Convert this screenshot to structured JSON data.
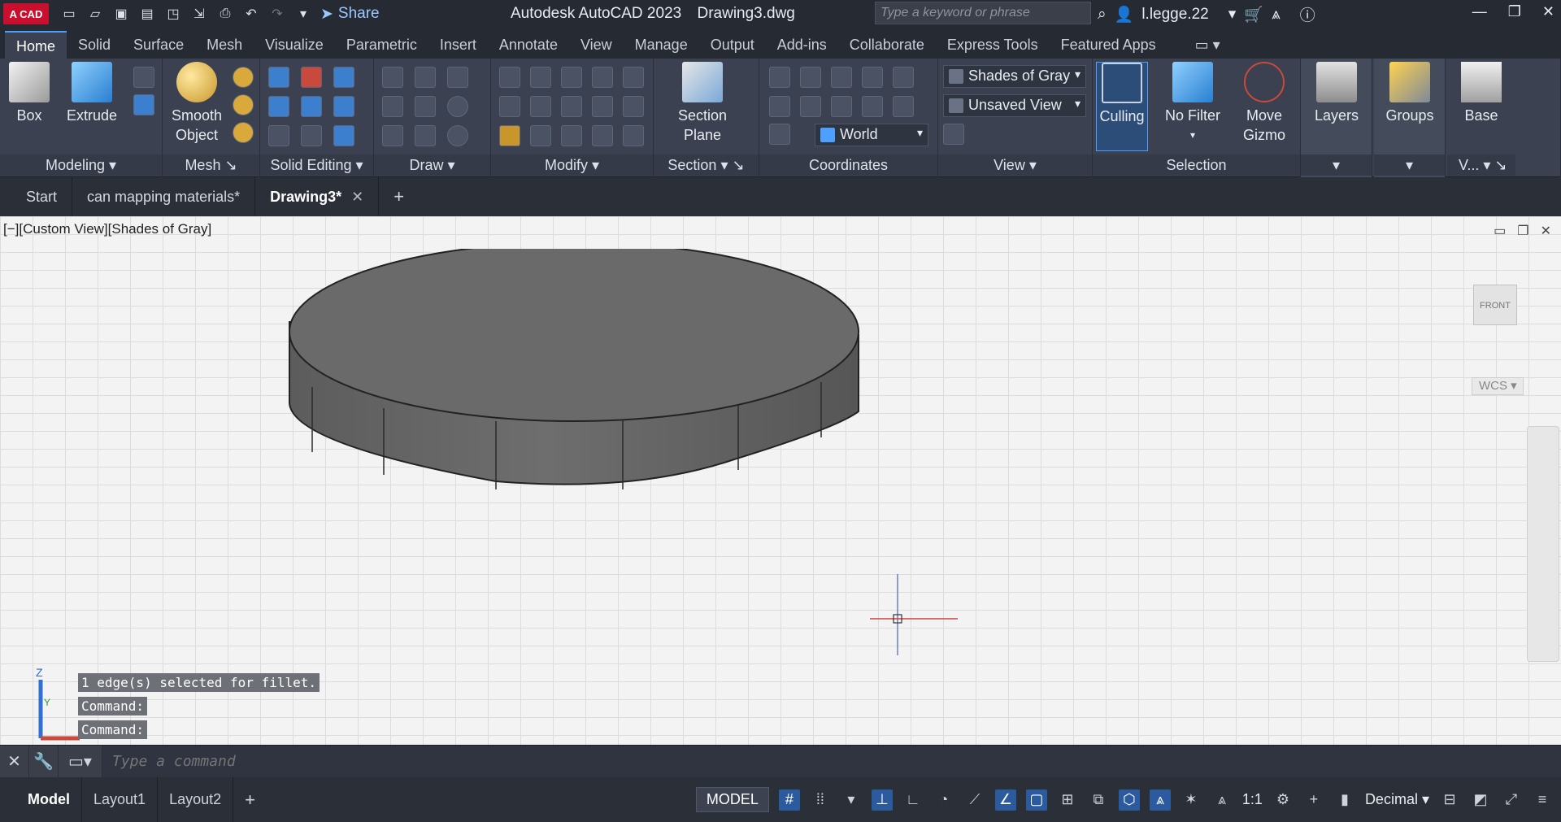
{
  "app": {
    "logo_text": "A CAD",
    "title": "Autodesk AutoCAD 2023",
    "filename": "Drawing3.dwg",
    "share_label": "Share",
    "search_placeholder": "Type a keyword or phrase",
    "username": "l.legge.22"
  },
  "ribbon_tabs": [
    "Home",
    "Solid",
    "Surface",
    "Mesh",
    "Visualize",
    "Parametric",
    "Insert",
    "Annotate",
    "View",
    "Manage",
    "Output",
    "Add-ins",
    "Collaborate",
    "Express Tools",
    "Featured Apps"
  ],
  "ribbon": {
    "modeling": {
      "label": "Modeling",
      "box": "Box",
      "extrude": "Extrude"
    },
    "mesh": {
      "label": "Mesh",
      "smooth_object_l1": "Smooth",
      "smooth_object_l2": "Object"
    },
    "solid_editing": {
      "label": "Solid Editing"
    },
    "draw": {
      "label": "Draw"
    },
    "modify": {
      "label": "Modify"
    },
    "section": {
      "label": "Section",
      "plane_l1": "Section",
      "plane_l2": "Plane"
    },
    "coordinates": {
      "label": "Coordinates",
      "ucs_value": "World"
    },
    "view": {
      "label": "View",
      "visual_style": "Shades of Gray",
      "named_view": "Unsaved View"
    },
    "selection": {
      "label": "Selection",
      "culling": "Culling",
      "no_filter": "No Filter",
      "move_gizmo_l1": "Move",
      "move_gizmo_l2": "Gizmo"
    },
    "layers": {
      "label": "Layers"
    },
    "groups": {
      "label": "Groups"
    },
    "base": {
      "label": "Base",
      "sub_label": "V..."
    }
  },
  "doc_tabs": {
    "start": "Start",
    "tab1": "can mapping materials*",
    "tab2": "Drawing3*"
  },
  "viewport": {
    "label": "[−][Custom View][Shades of Gray]",
    "viewcube_face": "FRONT",
    "wcs_label": "WCS",
    "ucs_z": "Z",
    "ucs_y": "Y"
  },
  "command_history": [
    "1 edge(s) selected for fillet.",
    "Command:",
    "Command:"
  ],
  "command_line": {
    "placeholder": "Type a command"
  },
  "layout_tabs": [
    "Model",
    "Layout1",
    "Layout2"
  ],
  "status": {
    "model": "MODEL",
    "scale": "1:1",
    "units": "Decimal"
  },
  "colors": {
    "accent": "#4ea0ff",
    "ribbon_bg": "#3b4150",
    "viewport_bg": "#f3f3f3",
    "logo": "#c8102e"
  }
}
